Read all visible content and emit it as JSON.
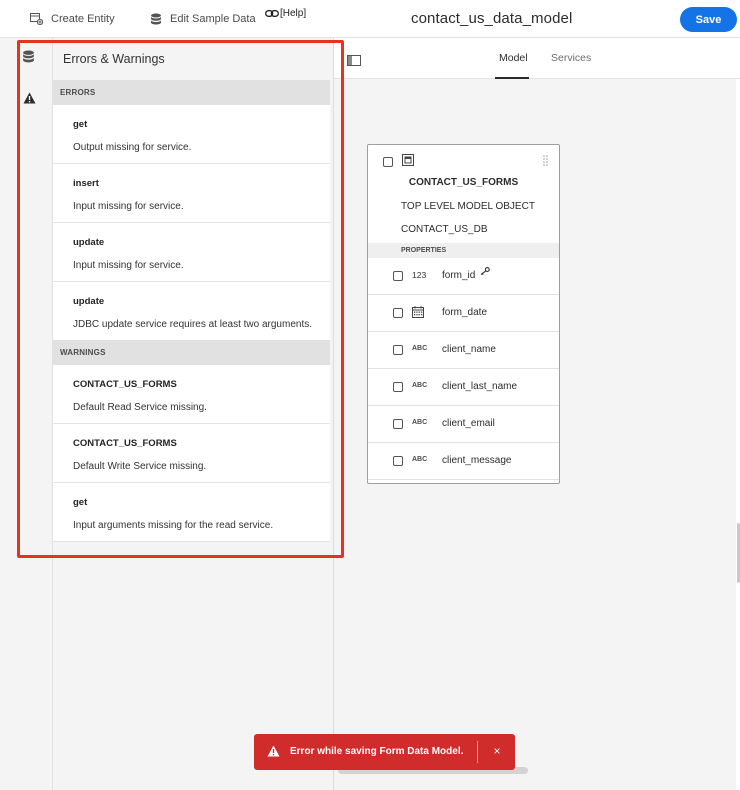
{
  "toolbar": {
    "create_entity_label": "Create Entity",
    "edit_sample_data_label": "Edit Sample Data",
    "help_label": "[Help]",
    "title": "contact_us_data_model",
    "save_label": "Save"
  },
  "panel": {
    "title": "Errors & Warnings",
    "errors_header": "ERRORS",
    "warnings_header": "WARNINGS",
    "errors": [
      {
        "title": "get",
        "text": "Output missing for service."
      },
      {
        "title": "insert",
        "text": "Input missing for service."
      },
      {
        "title": "update",
        "text": "Input missing for service."
      },
      {
        "title": "update",
        "text": "JDBC update service requires at least two arguments."
      }
    ],
    "warnings": [
      {
        "title": "CONTACT_US_FORMS",
        "text": "Default Read Service missing."
      },
      {
        "title": "CONTACT_US_FORMS",
        "text": "Default Write Service missing."
      },
      {
        "title": "get",
        "text": "Input arguments missing for the read service."
      }
    ]
  },
  "canvas": {
    "tabs": [
      {
        "label": "Model",
        "active": true
      },
      {
        "label": "Services",
        "active": false
      }
    ],
    "entity": {
      "name": "CONTACT_US_FORMS",
      "level": "TOP LEVEL MODEL OBJECT",
      "datasource": "CONTACT_US_DB",
      "properties_header": "PROPERTIES",
      "properties": [
        {
          "type": "123",
          "name": "form_id",
          "key": true
        },
        {
          "type": "date",
          "name": "form_date"
        },
        {
          "type": "ABC",
          "name": "client_name"
        },
        {
          "type": "ABC",
          "name": "client_last_name"
        },
        {
          "type": "ABC",
          "name": "client_email"
        },
        {
          "type": "ABC",
          "name": "client_message"
        }
      ]
    }
  },
  "toast": {
    "text": "Error while saving Form Data Model.",
    "close": "×"
  },
  "colors": {
    "accent": "#1473e6",
    "error": "#d12c2c",
    "highlight": "#e8331c"
  },
  "icons": [
    "create-entity-icon",
    "database-icon",
    "link-icon",
    "warning-icon",
    "panel-toggle-icon",
    "entity-icon",
    "grip-icon",
    "calendar-icon",
    "key-icon",
    "close-icon"
  ]
}
